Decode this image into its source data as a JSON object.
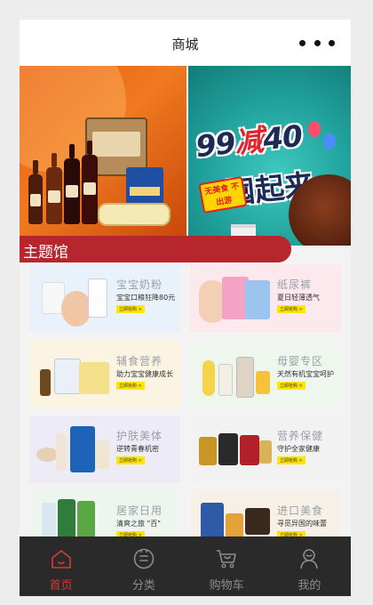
{
  "header": {
    "title": "商城",
    "more_icon": "more-dots-icon"
  },
  "banner": {
    "slides": [
      {
        "name": "wine-promo"
      },
      {
        "name": "discount-promo",
        "headline_a": "99",
        "headline_b": "减",
        "headline_c": "40",
        "headline_line2": "囤起来",
        "tag": "无美食 不出游"
      }
    ],
    "active_dot": 2,
    "dot_count": 3
  },
  "section": {
    "title": "主题馆",
    "color": "#b8262d"
  },
  "categories": [
    {
      "title": "宝宝奶粉",
      "subtitle": "宝宝口粮狂降80元",
      "button": "立即抢购 >",
      "bg": "#e9f2fa"
    },
    {
      "title": "纸尿裤",
      "subtitle": "夏日轻薄透气",
      "button": "立即抢购 >",
      "bg": "#fce9ee"
    },
    {
      "title": "辅食营养",
      "subtitle": "助力宝宝健康成长",
      "button": "立即抢购 >",
      "bg": "#fbf4e3"
    },
    {
      "title": "母婴专区",
      "subtitle": "天然有机宝宝呵护",
      "button": "立即抢购 >",
      "bg": "#eef6ee"
    },
    {
      "title": "护肤美体",
      "subtitle": "逆转青春机密",
      "button": "立即抢购 >",
      "bg": "#ecebf6"
    },
    {
      "title": "营养保健",
      "subtitle": "守护全家健康",
      "button": "立即抢购 >",
      "bg": "#f2f2f2"
    },
    {
      "title": "居家日用",
      "subtitle": "清爽之旅 \"百\"",
      "button": "立即抢购 >",
      "bg": "#eef4ee"
    },
    {
      "title": "进口美食",
      "subtitle": "寻觅异国的味蕾",
      "button": "立即抢购 >",
      "bg": "#f6f0e6"
    }
  ],
  "tabbar": {
    "items": [
      {
        "label": "首页",
        "icon": "home-icon",
        "active": true
      },
      {
        "label": "分类",
        "icon": "category-icon",
        "active": false
      },
      {
        "label": "购物车",
        "icon": "cart-icon",
        "active": false
      },
      {
        "label": "我的",
        "icon": "user-icon",
        "active": false
      }
    ],
    "active_color": "#d43a3a",
    "inactive_color": "#8c8c8c"
  }
}
